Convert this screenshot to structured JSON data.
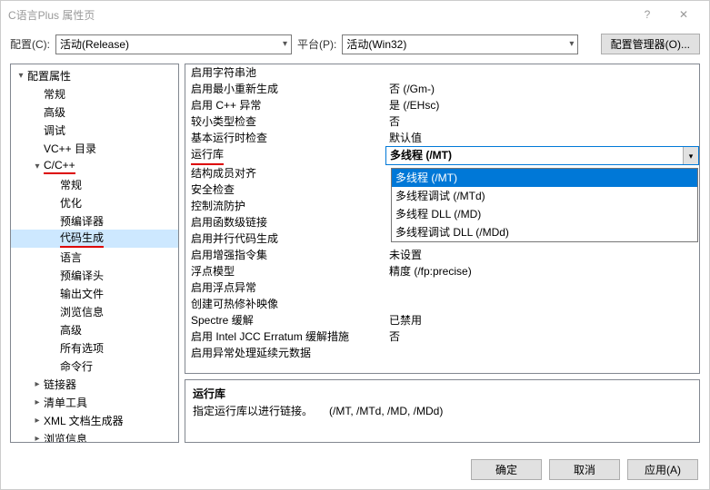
{
  "titlebar": {
    "title": "C语言Plus 属性页",
    "help": "?",
    "close": "✕"
  },
  "config": {
    "cfg_label": "配置(C):",
    "cfg_value": "活动(Release)",
    "plat_label": "平台(P):",
    "plat_value": "活动(Win32)",
    "mgr_btn": "配置管理器(O)..."
  },
  "tree": [
    {
      "label": "配置属性",
      "indent": 0,
      "arrow": "▾",
      "expanded": true
    },
    {
      "label": "常规",
      "indent": 1,
      "arrow": ""
    },
    {
      "label": "高级",
      "indent": 1,
      "arrow": ""
    },
    {
      "label": "调试",
      "indent": 1,
      "arrow": ""
    },
    {
      "label": "VC++ 目录",
      "indent": 1,
      "arrow": ""
    },
    {
      "label": "C/C++",
      "indent": 1,
      "arrow": "▾",
      "underline": true
    },
    {
      "label": "常规",
      "indent": 2,
      "arrow": ""
    },
    {
      "label": "优化",
      "indent": 2,
      "arrow": ""
    },
    {
      "label": "预编译器",
      "indent": 2,
      "arrow": ""
    },
    {
      "label": "代码生成",
      "indent": 2,
      "arrow": "",
      "selected": true,
      "underline": true
    },
    {
      "label": "语言",
      "indent": 2,
      "arrow": ""
    },
    {
      "label": "预编译头",
      "indent": 2,
      "arrow": ""
    },
    {
      "label": "输出文件",
      "indent": 2,
      "arrow": ""
    },
    {
      "label": "浏览信息",
      "indent": 2,
      "arrow": ""
    },
    {
      "label": "高级",
      "indent": 2,
      "arrow": ""
    },
    {
      "label": "所有选项",
      "indent": 2,
      "arrow": ""
    },
    {
      "label": "命令行",
      "indent": 2,
      "arrow": ""
    },
    {
      "label": "链接器",
      "indent": 1,
      "arrow": "▸"
    },
    {
      "label": "清单工具",
      "indent": 1,
      "arrow": "▸"
    },
    {
      "label": "XML 文档生成器",
      "indent": 1,
      "arrow": "▸"
    },
    {
      "label": "浏览信息",
      "indent": 1,
      "arrow": "▸"
    }
  ],
  "props": [
    {
      "name": "启用字符串池",
      "value": ""
    },
    {
      "name": "启用最小重新生成",
      "value": "否 (/Gm-)"
    },
    {
      "name": "启用 C++ 异常",
      "value": "是 (/EHsc)"
    },
    {
      "name": "较小类型检查",
      "value": "否"
    },
    {
      "name": "基本运行时检查",
      "value": "默认值"
    },
    {
      "name": "运行库",
      "value": "多线程 (/MT)",
      "highlight": true,
      "underline": true
    },
    {
      "name": "结构成员对齐",
      "value": ""
    },
    {
      "name": "安全检查",
      "value": ""
    },
    {
      "name": "控制流防护",
      "value": ""
    },
    {
      "name": "启用函数级链接",
      "value": ""
    },
    {
      "name": "启用并行代码生成",
      "value": ""
    },
    {
      "name": "启用增强指令集",
      "value": "未设置"
    },
    {
      "name": "浮点模型",
      "value": "精度 (/fp:precise)"
    },
    {
      "name": "启用浮点异常",
      "value": ""
    },
    {
      "name": "创建可热修补映像",
      "value": ""
    },
    {
      "name": "Spectre 缓解",
      "value": "已禁用"
    },
    {
      "name": "启用 Intel JCC Erratum 缓解措施",
      "value": "否"
    },
    {
      "name": "启用异常处理延续元数据",
      "value": ""
    }
  ],
  "dropdown": {
    "options": [
      {
        "label": "多线程 (/MT)",
        "sel": true
      },
      {
        "label": "多线程调试 (/MTd)"
      },
      {
        "label": "多线程 DLL (/MD)"
      },
      {
        "label": "多线程调试 DLL (/MDd)"
      }
    ]
  },
  "desc": {
    "title": "运行库",
    "body": "指定运行库以进行链接。　　(/MT, /MTd, /MD, /MDd)"
  },
  "footer": {
    "ok": "确定",
    "cancel": "取消",
    "apply": "应用(A)"
  }
}
